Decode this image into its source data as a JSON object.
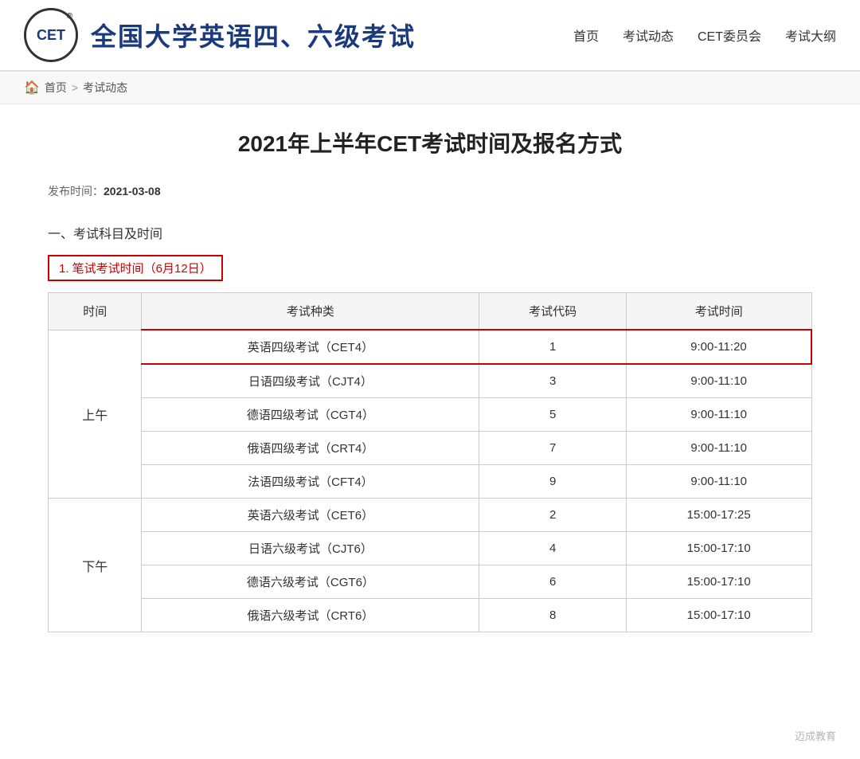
{
  "header": {
    "logo_text": "CET",
    "site_title": "全国大学英语四、六级考试",
    "nav_items": [
      "首页",
      "考试动态",
      "CET委员会",
      "考试大纲"
    ]
  },
  "breadcrumb": {
    "home_label": "首页",
    "separator": ">",
    "current": "考试动态"
  },
  "article": {
    "title": "2021年上半年CET考试时间及报名方式",
    "publish_label": "发布时间：",
    "publish_date": "2021-03-08",
    "section1_title": "一、考试科目及时间",
    "subsection1_label": "1. 笔试考试时间（6月12日）"
  },
  "table": {
    "headers": [
      "时间",
      "考试种类",
      "考试代码",
      "考试时间"
    ],
    "rows": [
      {
        "period": "上午",
        "rowspan": 5,
        "items": [
          {
            "name": "英语四级考试（CET4）",
            "code": "1",
            "time": "9:00-11:20",
            "highlight": true
          },
          {
            "name": "日语四级考试（CJT4）",
            "code": "3",
            "time": "9:00-11:10",
            "highlight": false
          },
          {
            "name": "德语四级考试（CGT4）",
            "code": "5",
            "time": "9:00-11:10",
            "highlight": false
          },
          {
            "name": "俄语四级考试（CRT4）",
            "code": "7",
            "time": "9:00-11:10",
            "highlight": false
          },
          {
            "name": "法语四级考试（CFT4）",
            "code": "9",
            "time": "9:00-11:10",
            "highlight": false
          }
        ]
      },
      {
        "period": "下午",
        "rowspan": 4,
        "items": [
          {
            "name": "英语六级考试（CET6）",
            "code": "2",
            "time": "15:00-17:25",
            "highlight": false
          },
          {
            "name": "日语六级考试（CJT6）",
            "code": "4",
            "time": "15:00-17:10",
            "highlight": false
          },
          {
            "name": "德语六级考试（CGT6）",
            "code": "6",
            "time": "15:00-17:10",
            "highlight": false
          },
          {
            "name": "俄语六级考试（CRT6）",
            "code": "8",
            "time": "15:00-17:10",
            "highlight": false
          }
        ]
      }
    ]
  },
  "watermark": {
    "text": "迈成教育"
  }
}
